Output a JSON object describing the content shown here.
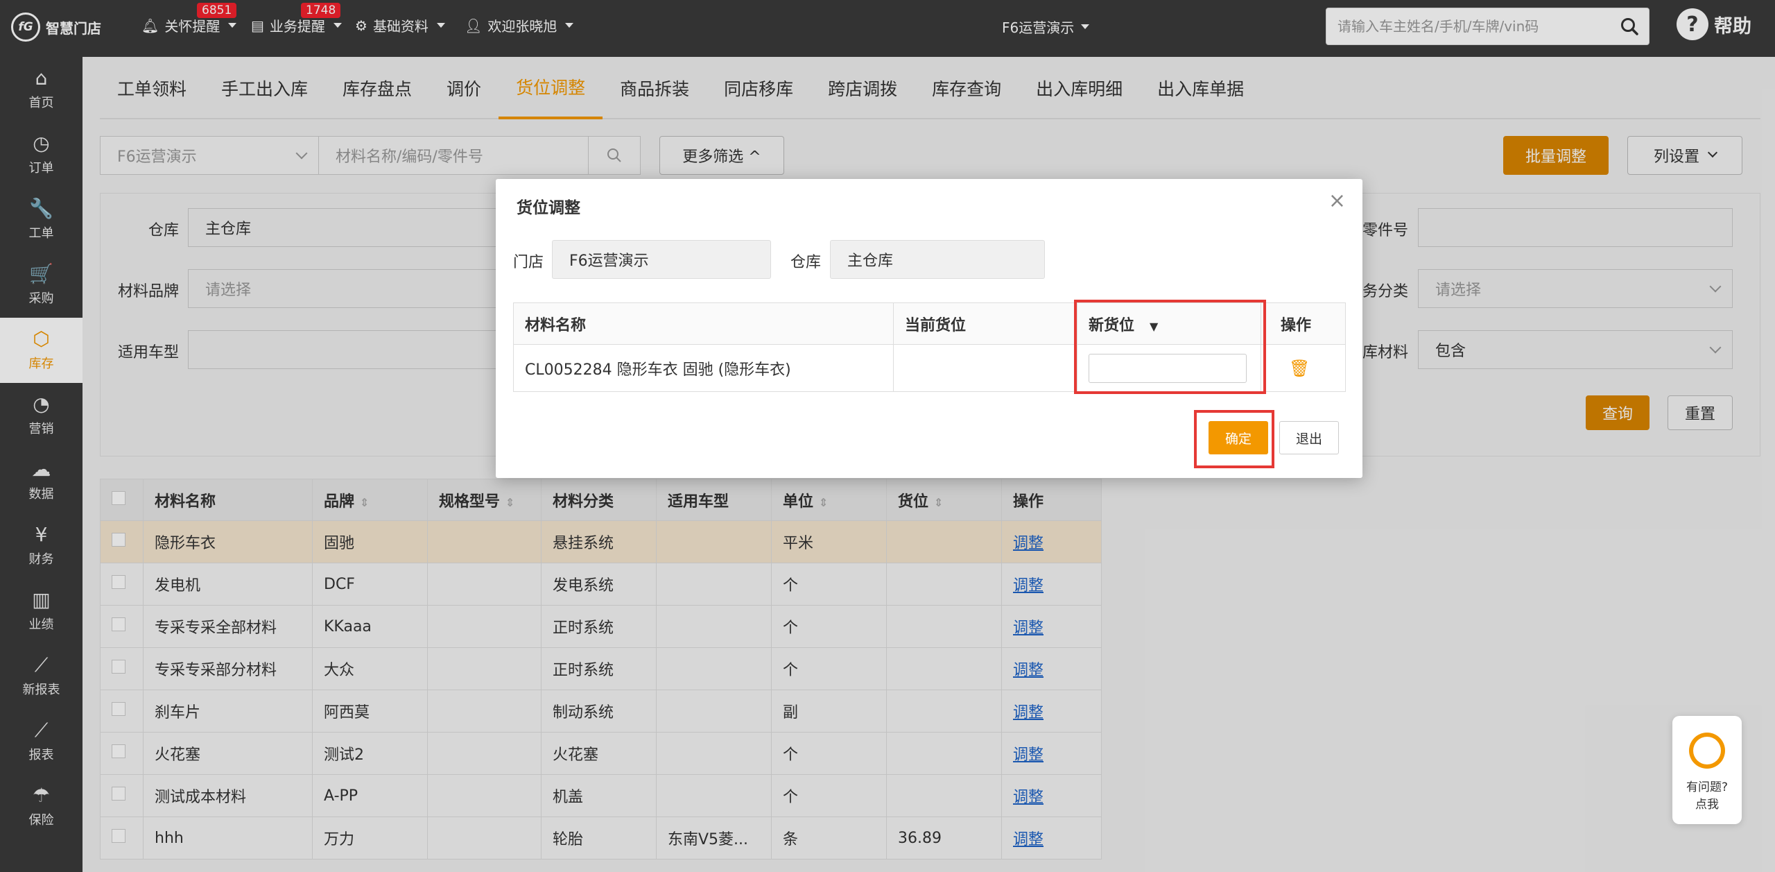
{
  "app": {
    "name": "智慧门店",
    "logo_mark": "fG"
  },
  "topbar": {
    "care_reminder": {
      "label": "关怀提醒",
      "badge": "6851"
    },
    "business_reminder": {
      "label": "业务提醒",
      "badge": "1748"
    },
    "basic_data": {
      "label": "基础资料"
    },
    "welcome": {
      "label": "欢迎张晓旭"
    },
    "store": "F6运营演示",
    "search_placeholder": "请输入车主姓名/手机/车牌/vin码",
    "help": "帮助"
  },
  "sidebar": {
    "items": [
      {
        "label": "首页",
        "icon": "home-icon",
        "glyph": "⌂"
      },
      {
        "label": "订单",
        "icon": "clock-icon",
        "glyph": "◷"
      },
      {
        "label": "工单",
        "icon": "wrench-icon",
        "glyph": "🔧"
      },
      {
        "label": "采购",
        "icon": "cart-icon",
        "glyph": "🛒"
      },
      {
        "label": "库存",
        "icon": "box-icon",
        "glyph": "⬡"
      },
      {
        "label": "营销",
        "icon": "pie-icon",
        "glyph": "◔"
      },
      {
        "label": "数据",
        "icon": "cloud-icon",
        "glyph": "☁"
      },
      {
        "label": "财务",
        "icon": "yen-icon",
        "glyph": "¥"
      },
      {
        "label": "业绩",
        "icon": "bar-chart-icon",
        "glyph": "▥"
      },
      {
        "label": "新报表",
        "icon": "line-chart-icon",
        "glyph": "⟋"
      },
      {
        "label": "报表",
        "icon": "report-icon",
        "glyph": "⟋"
      },
      {
        "label": "保险",
        "icon": "umbrella-icon",
        "glyph": "☂"
      }
    ],
    "active_label": "库存"
  },
  "page_tabs": [
    "工单领料",
    "手工出入库",
    "库存盘点",
    "调价",
    "货位调整",
    "商品拆装",
    "同店移库",
    "跨店调拨",
    "库存查询",
    "出入库明细",
    "出入库单据"
  ],
  "active_tab": "货位调整",
  "filters": {
    "store": "F6运营演示",
    "material_placeholder": "材料名称/编码/零件号",
    "more_filter": "更多筛选 ^",
    "batch_adjust": "批量调整",
    "column_settings": "列设置",
    "warehouse_label": "仓库",
    "warehouse_value": "主仓库",
    "brand_label": "材料品牌",
    "brand_placeholder": "请选择",
    "car_label": "适用车型",
    "part_no_label": "零件号",
    "biz_category_label": "务分类",
    "biz_category_placeholder": "请选择",
    "stock_material_label": "库材料",
    "stock_material_value": "包含",
    "query": "查询",
    "reset": "重置"
  },
  "table": {
    "headers": [
      "材料名称",
      "品牌",
      "规格型号",
      "材料分类",
      "适用车型",
      "单位",
      "货位",
      "操作"
    ],
    "rows": [
      [
        "隐形车衣",
        "固驰",
        "",
        "悬挂系统",
        "",
        "平米",
        "",
        "调整"
      ],
      [
        "发电机",
        "DCF",
        "",
        "发电系统",
        "",
        "个",
        "",
        "调整"
      ],
      [
        "专采专采全部材料",
        "KKaaa",
        "",
        "正时系统",
        "",
        "个",
        "",
        "调整"
      ],
      [
        "专采专采部分材料",
        "大众",
        "",
        "正时系统",
        "",
        "个",
        "",
        "调整"
      ],
      [
        "刹车片",
        "阿西莫",
        "",
        "制动系统",
        "",
        "副",
        "",
        "调整"
      ],
      [
        "火花塞",
        "测试2",
        "",
        "火花塞",
        "",
        "个",
        "",
        "调整"
      ],
      [
        "测试成本材料",
        "A-PP",
        "",
        "机盖",
        "",
        "个",
        "",
        "调整"
      ],
      [
        "hhh",
        "万力",
        "",
        "轮胎",
        "东南V5菱...",
        "条",
        "36.89",
        "调整"
      ]
    ]
  },
  "modal": {
    "title": "货位调整",
    "store_label": "门店",
    "store_value": "F6运营演示",
    "warehouse_label": "仓库",
    "warehouse_value": "主仓库",
    "headers": [
      "材料名称",
      "当前货位",
      "新货位",
      "操作"
    ],
    "row": {
      "material": "CL0052284 隐形车衣 固驰 (隐形车衣)",
      "current_location": "",
      "new_location": ""
    },
    "ok": "确定",
    "exit": "退出"
  },
  "float_help": {
    "line1": "有问题?",
    "line2": "点我"
  }
}
